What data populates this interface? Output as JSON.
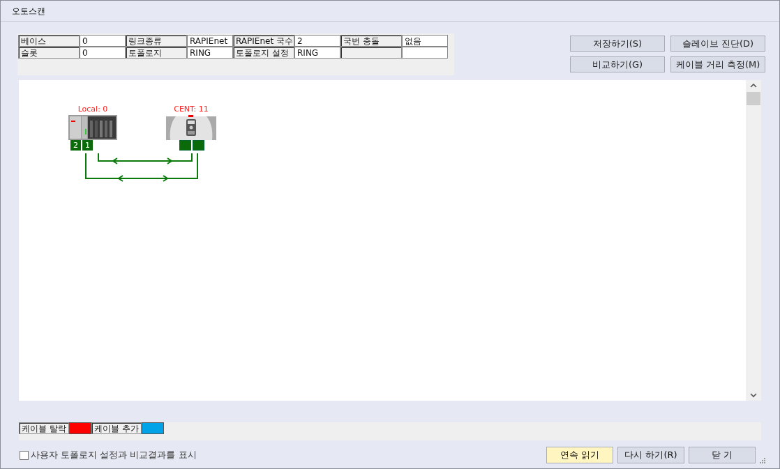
{
  "window": {
    "title": "오토스캔"
  },
  "info_table": {
    "rows": [
      [
        {
          "label": "베이스",
          "value": "0"
        },
        {
          "label": "링크종류",
          "value": "RAPIEnet"
        },
        {
          "label": "RAPIEnet 국수",
          "value": "2"
        },
        {
          "label": "국번 충돌",
          "value": "없음"
        }
      ],
      [
        {
          "label": "슬롯",
          "value": "0"
        },
        {
          "label": "토폴로지",
          "value": "RING"
        },
        {
          "label": "토폴로지 설정",
          "value": "RING"
        }
      ]
    ]
  },
  "action_buttons": [
    {
      "label": "저장하기(S)"
    },
    {
      "label": "슬레이브 진단(D)"
    },
    {
      "label": "비교하기(G)"
    },
    {
      "label": "케이블 거리 측정(M)"
    }
  ],
  "topology": {
    "nodes": [
      {
        "kind": "plc",
        "label": "Local: 0",
        "ports": [
          "2",
          "1"
        ]
      },
      {
        "kind": "drive",
        "label": "CENT: 11"
      }
    ]
  },
  "legend": [
    {
      "label": "케이블 탈락",
      "color": "#ff0000"
    },
    {
      "label": "케이블 추가",
      "color": "#00a2e8"
    }
  ],
  "compare_checkbox": {
    "label": "사용자 토폴로지 설정과 비교결과를 표시",
    "checked": false
  },
  "bottom_buttons": [
    {
      "label": "연속 읽기",
      "kind": "default"
    },
    {
      "label": "다시 하기(R)",
      "kind": "normal"
    },
    {
      "label": "닫 기",
      "kind": "normal"
    }
  ]
}
